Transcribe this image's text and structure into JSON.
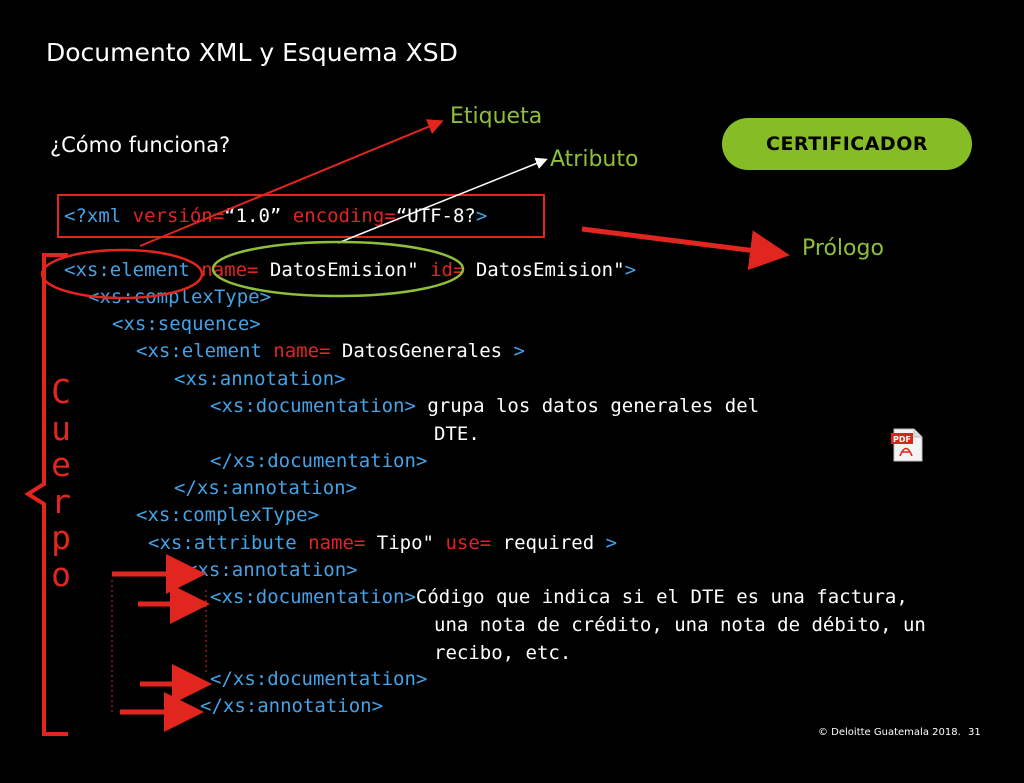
{
  "slide": {
    "title": "Documento XML y Esquema XSD",
    "question": "¿Cómo funciona?",
    "certificador_button": "CERTIFICADOR",
    "labels": {
      "etiqueta": "Etiqueta",
      "atributo": "Atributo",
      "prologo": "Prólogo",
      "cuerpo": [
        "C",
        "u",
        "e",
        "r",
        "p",
        "o"
      ]
    },
    "footer": {
      "copyright": "© Deloitte Guatemala 2018.",
      "page": "31"
    },
    "pdf_icon_label": "PDF"
  },
  "code": {
    "prolog": {
      "open": "<?xml ",
      "attr1": "versión=",
      "val1": "“1.0” ",
      "attr2": "encoding=",
      "val2": "“UTF-8?",
      "close": ">"
    },
    "l1": {
      "open": "<xs:element ",
      "a1": "name= ",
      "v1": "DatosEmision\" ",
      "a2": "id= ",
      "v2": "DatosEmision\"",
      "close": ">"
    },
    "l2": {
      "tag": "<xs:complexType>"
    },
    "l3": {
      "tag": "<xs:sequence>"
    },
    "l4": {
      "open": "<xs:element ",
      "a1": "name= ",
      "v1": "DatosGenerales ",
      "close": ">"
    },
    "l5": {
      "tag": "<xs:annotation>"
    },
    "l6": {
      "tag": "<xs:documentation>",
      "text": " grupa los datos generales del"
    },
    "l7": {
      "text": "DTE."
    },
    "l8": {
      "tag": "</xs:documentation>"
    },
    "l9": {
      "tag": "</xs:annotation>"
    },
    "l10": {
      "tag": "<xs:complexType>"
    },
    "l11": {
      "open": "<xs:attribute ",
      "a1": "name= ",
      "v1": "Tipo\" ",
      "a2": "use= ",
      "v2": "required ",
      "close": ">"
    },
    "l12": {
      "tag": "<xs:annotation>"
    },
    "l13": {
      "tag": "<xs:documentation>",
      "text": "Código que indica si el DTE es una factura,"
    },
    "l14": {
      "text": "una nota de crédito, una nota de débito, un"
    },
    "l15": {
      "text": "recibo, etc."
    },
    "l16": {
      "tag": "</xs:documentation>"
    },
    "l17": {
      "tag": "</xs:annotation>"
    }
  },
  "colors": {
    "tag": "#44a2e6",
    "attribute": "#e02424",
    "accent_green": "#86bc25",
    "annotation_red": "#e0261e"
  }
}
